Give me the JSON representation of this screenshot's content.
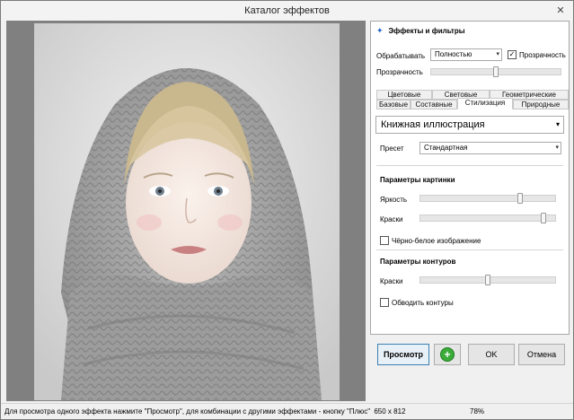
{
  "window": {
    "title": "Каталог эффектов"
  },
  "panel": {
    "title": "Эффекты и фильтры",
    "process_label": "Обрабатывать",
    "process_value": "Полностью",
    "transparency_check_label": "Прозрачность",
    "transparency_checked": true,
    "transparency_slider_label": "Прозрачность",
    "transparency_level_pct": 50
  },
  "tabs": {
    "row1": [
      "Цветовые",
      "Световые",
      "Геометрические"
    ],
    "row2": [
      "Базовые",
      "Составные",
      "Стилизация",
      "Природные"
    ],
    "active": "Стилизация"
  },
  "effect": {
    "selected": "Книжная иллюстрация",
    "preset_label": "Пресет",
    "preset_value": "Стандартная",
    "picture_section": "Параметры картинки",
    "brightness_label": "Яркость",
    "brightness_pct": 75,
    "colors_label": "Краски",
    "colors_pct": 93,
    "bw_label": "Чёрно-белое изображение",
    "bw_checked": false,
    "contour_section": "Параметры контуров",
    "contour_colors_label": "Краски",
    "contour_colors_pct": 50,
    "outline_label": "Обводить контуры",
    "outline_checked": false
  },
  "buttons": {
    "preview": "Просмотр",
    "add_icon": "plus-circle-icon",
    "ok": "OK",
    "cancel": "Отмена"
  },
  "status": {
    "hint": "Для просмотра одного эффекта нажмите \"Просмотр\", для комбинации с другими эффектами - кнопку \"Плюс\"",
    "dims": "650 x 812",
    "zoom": "78%"
  },
  "colors": {
    "accent": "#1e63c8",
    "add_green": "#3bab3a",
    "preview_bg": "#808080"
  }
}
